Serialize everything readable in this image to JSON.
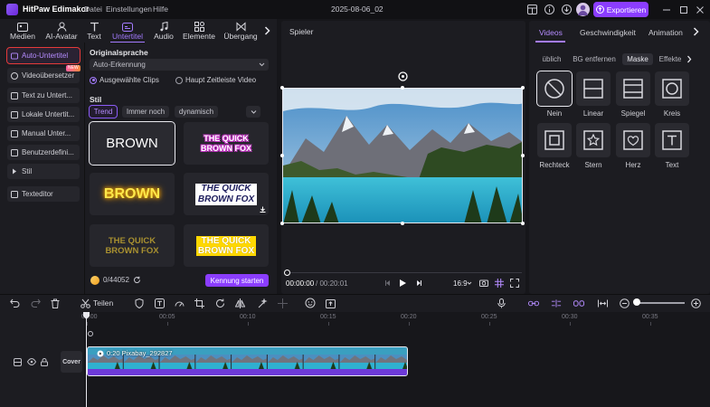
{
  "app": {
    "name": "HitPaw Edimakor",
    "menu": [
      "Datei",
      "Einstellungen",
      "Hilfe"
    ],
    "project_name": "2025-08-06_02",
    "export_label": "Exportieren"
  },
  "tool_tabs": [
    {
      "label": "Medien",
      "icon": "media-icon"
    },
    {
      "label": "AI-Avatar",
      "icon": "avatar-icon"
    },
    {
      "label": "Text",
      "icon": "text-icon"
    },
    {
      "label": "Untertitel",
      "icon": "subtitle-icon",
      "active": true
    },
    {
      "label": "Audio",
      "icon": "audio-icon"
    },
    {
      "label": "Elemente",
      "icon": "elements-icon"
    },
    {
      "label": "Übergang",
      "icon": "transition-icon"
    }
  ],
  "sidebar": {
    "items": [
      {
        "label": "Auto-Untertitel",
        "active": true
      },
      {
        "label": "Videoübersetzer"
      },
      {
        "label": "Text zu Untert..."
      },
      {
        "label": "Lokale Untertit..."
      },
      {
        "label": "Manual Unter..."
      },
      {
        "label": "Benutzerdefini..."
      },
      {
        "label": "Stil"
      },
      {
        "label": "Texteditor"
      }
    ],
    "badge": "NEW"
  },
  "subtitle_panel": {
    "source_language_title": "Originalsprache",
    "language_value": "Auto-Erkennung",
    "radio_selected_clips": "Ausgewählte Clips",
    "radio_main_timeline": "Haupt Zeitleiste Video",
    "style_title": "Stil",
    "chips": [
      "Trend",
      "Immer noch",
      "dynamisch"
    ],
    "styles": [
      {
        "line1": "BROWN",
        "line2": ""
      },
      {
        "line1": "THE QUICK",
        "line2": "BROWN FOX"
      },
      {
        "line1": "BROWN",
        "line2": ""
      },
      {
        "line1": "THE QUICK",
        "line2": "BROWN FOX"
      },
      {
        "line1": "THE QUICK",
        "line2": "BROWN FOX"
      },
      {
        "line1": "THE QUICK",
        "line2": "BROWN FOX"
      }
    ],
    "credits": "0/44052",
    "start_label": "Kennung starten"
  },
  "player": {
    "title": "Spieler",
    "current_time": "00:00:00",
    "total_time": "/ 00:20:01",
    "aspect": "16:9"
  },
  "right_panel": {
    "tabs": [
      "Videos",
      "Geschwindigkeit",
      "Animation"
    ],
    "sub_tabs": [
      "üblich",
      "BG entfernen",
      "Maske",
      "Effekte"
    ],
    "masks": [
      {
        "label": "Nein",
        "icon": "none-mask-icon"
      },
      {
        "label": "Linear",
        "icon": "linear-mask-icon"
      },
      {
        "label": "Spiegel",
        "icon": "mirror-mask-icon"
      },
      {
        "label": "Kreis",
        "icon": "circle-mask-icon"
      },
      {
        "label": "Rechteck",
        "icon": "rectangle-mask-icon"
      },
      {
        "label": "Stern",
        "icon": "star-mask-icon"
      },
      {
        "label": "Herz",
        "icon": "heart-mask-icon"
      },
      {
        "label": "Text",
        "icon": "text-mask-icon"
      }
    ]
  },
  "timeline": {
    "split_label": "Teilen",
    "ruler": [
      "00:00",
      "00:05",
      "00:10",
      "00:15",
      "00:20",
      "00:25",
      "00:30",
      "00:35"
    ],
    "cover_label": "Cover",
    "clip_label": "0:20 Pixabay_292827"
  },
  "colors": {
    "accent": "#8b3dff",
    "accent_text": "#a47bff",
    "highlight_outline": "#e53a3a"
  }
}
